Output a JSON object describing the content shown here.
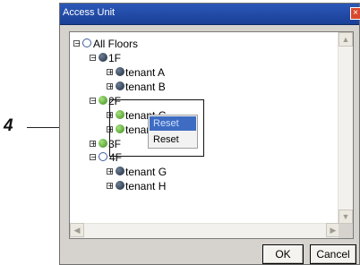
{
  "callout": {
    "number": "4"
  },
  "window": {
    "title": "Access Unit",
    "close_glyph": "×"
  },
  "tree": [
    {
      "label": "All Floors",
      "expander": "−",
      "icon": "open-circle-icon",
      "expanded": true
    },
    {
      "label": "1F",
      "expander": "−",
      "icon": "dark-globe-icon",
      "expanded": true
    },
    {
      "label": "tenant A",
      "expander": "+",
      "icon": "dark-globe-icon"
    },
    {
      "label": "tenant B",
      "expander": "+",
      "icon": "dark-globe-icon"
    },
    {
      "label": "2F",
      "expander": "−",
      "icon": "green-globe-icon",
      "expanded": true
    },
    {
      "label": "tenant C",
      "expander": "+",
      "icon": "green-globe-icon",
      "selected": true
    },
    {
      "label": "tenant D",
      "expander": "+",
      "icon": "green-globe-icon"
    },
    {
      "label": "3F",
      "expander": "+",
      "icon": "green-globe-icon"
    },
    {
      "label": "4F",
      "expander": "−",
      "icon": "open-circle-icon",
      "expanded": true
    },
    {
      "label": "tenant G",
      "expander": "+",
      "icon": "dark-globe-icon"
    },
    {
      "label": "tenant H",
      "expander": "+",
      "icon": "dark-globe-icon"
    }
  ],
  "context_menu": {
    "items": [
      "Reset",
      "Reset"
    ],
    "highlighted_index": 0
  },
  "buttons": {
    "ok": "OK",
    "cancel": "Cancel"
  },
  "scroll": {
    "up": "▲",
    "down": "▼",
    "left": "◀",
    "right": "▶"
  },
  "colors": {
    "titlebar": "#1f4aa6",
    "menu_highlight": "#3e6cc2",
    "dialog_bg": "#d6d3ce"
  }
}
